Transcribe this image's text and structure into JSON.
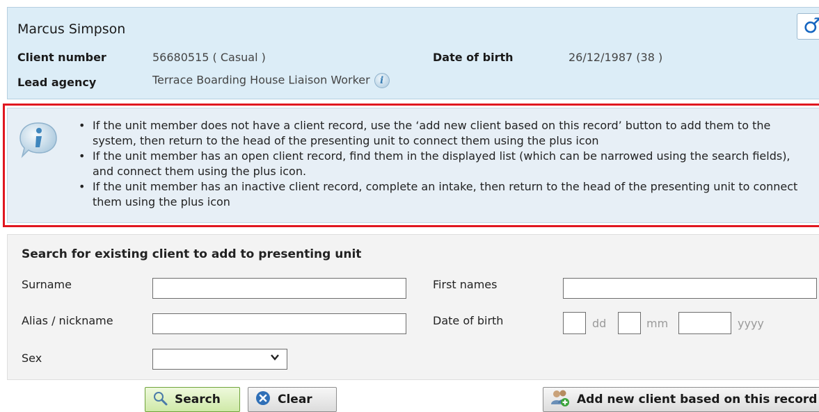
{
  "client": {
    "name": "Marcus Simpson",
    "gender_symbol": "♂",
    "client_number_label": "Client number",
    "client_number_value": "56680515 ( Casual )",
    "dob_label": "Date of birth",
    "dob_value": "26/12/1987 (38 )",
    "lead_agency_label": "Lead agency",
    "lead_agency_value": "Terrace Boarding House Liaison Worker"
  },
  "info": {
    "items": [
      "If the unit member does not have a client record, use the ‘add new client based on this record’ button to add them to the system, then return to the head of the presenting unit to connect them using the plus icon",
      "If the unit member has an open client record, find them in the displayed list (which can be narrowed using the search fields), and connect them using the plus icon.",
      "If the unit member has an inactive client record, complete an intake, then return to the head of the presenting unit to connect them using the plus icon"
    ]
  },
  "search": {
    "title": "Search for existing client to add to presenting unit",
    "surname_label": "Surname",
    "surname_value": "",
    "first_names_label": "First names",
    "first_names_value": "",
    "alias_label": "Alias / nickname",
    "alias_value": "",
    "dob_label": "Date of birth",
    "dd_placeholder": "dd",
    "mm_placeholder": "mm",
    "yyyy_placeholder": "yyyy",
    "sex_label": "Sex",
    "sex_value": ""
  },
  "buttons": {
    "search": "Search",
    "clear": "Clear",
    "add_new": "Add new client based on this record"
  },
  "icons": {
    "gender": "male-symbol-icon",
    "info": "info-icon",
    "search": "magnifier-icon",
    "clear": "clear-x-icon",
    "add_new": "add-people-icon"
  },
  "colors": {
    "client_panel_bg": "#dcedf7",
    "highlight_border": "#e0161f",
    "info_bg": "#e7eff6",
    "search_panel_bg": "#f3f3f3",
    "search_button_bg": "#d9efb8"
  }
}
